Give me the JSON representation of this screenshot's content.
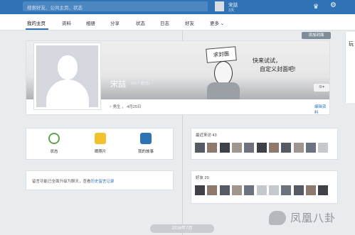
{
  "topbar": {
    "search_placeholder": "搜索好友、公共主页、状态",
    "user_name": "宋喆",
    "user_sub": "3天"
  },
  "tabs": [
    "我的主页",
    "资料",
    "相册",
    "分享",
    "状态",
    "日志",
    "好友",
    "更多 ⌄"
  ],
  "profile": {
    "add_cover_label": "添加封面",
    "name": "宋喆",
    "meta": "(43人看过) ♂",
    "birthday": "♂ 男生 ， 4月25日",
    "edit_label": "编辑资料",
    "sign_text": "求封面",
    "cover_caption_line1": "快来试试，",
    "cover_caption_line2": "自定义封面吧!"
  },
  "actions": [
    {
      "label": "状态",
      "icon": "status-bubble-icon"
    },
    {
      "label": "晒照片",
      "icon": "camera-icon"
    },
    {
      "label": "我的故事",
      "icon": "story-book-icon"
    }
  ],
  "notice": {
    "prefix": "留言功能已全面升级为聊天，查看",
    "link": "历史留言记录"
  },
  "visitors": {
    "title": "最近来访 43"
  },
  "friends": {
    "title": "好友 20"
  },
  "right_strip_text": "玩",
  "timeline_date": "2016年7月",
  "watermark": "凤凰八卦"
}
